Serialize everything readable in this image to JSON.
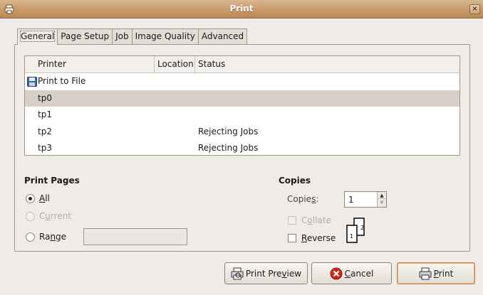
{
  "window": {
    "title": "Print"
  },
  "tabs": [
    {
      "label": "General"
    },
    {
      "label": "Page Setup"
    },
    {
      "label": "Job"
    },
    {
      "label": "Image Quality"
    },
    {
      "label": "Advanced"
    }
  ],
  "printer_list": {
    "headers": {
      "printer": "Printer",
      "location": "Location",
      "status": "Status"
    },
    "rows": [
      {
        "printer": "Print to File",
        "location": "",
        "status": "",
        "icon": "floppy-icon",
        "selected": false
      },
      {
        "printer": "tp0",
        "location": "",
        "status": "",
        "selected": true
      },
      {
        "printer": "tp1",
        "location": "",
        "status": "",
        "selected": false
      },
      {
        "printer": "tp2",
        "location": "",
        "status": "Rejecting Jobs",
        "selected": false
      },
      {
        "printer": "tp3",
        "location": "",
        "status": "Rejecting Jobs",
        "selected": false
      }
    ]
  },
  "print_pages": {
    "title": "Print Pages",
    "all": {
      "pre": "",
      "mnemonic": "A",
      "post": "ll",
      "checked": true
    },
    "current": {
      "pre": "C",
      "mnemonic": "u",
      "post": "rrent",
      "enabled": false
    },
    "range": {
      "pre": "Ra",
      "mnemonic": "n",
      "post": "ge",
      "value": ""
    }
  },
  "copies": {
    "title": "Copies",
    "label_pre": "Copie",
    "label_mnemonic": "s",
    "label_post": ":",
    "value": "1",
    "collate": {
      "pre": "C",
      "mnemonic": "o",
      "post": "llate",
      "enabled": false
    },
    "reverse": {
      "pre": "",
      "mnemonic": "R",
      "post": "everse",
      "checked": false
    },
    "graphic_pages": [
      "1",
      "2"
    ]
  },
  "buttons": {
    "preview": {
      "pre": "Print Pre",
      "mnemonic": "v",
      "post": "iew"
    },
    "cancel": {
      "pre": "",
      "mnemonic": "C",
      "post": "ancel"
    },
    "print": {
      "pre": "",
      "mnemonic": "P",
      "post": "rint"
    }
  }
}
